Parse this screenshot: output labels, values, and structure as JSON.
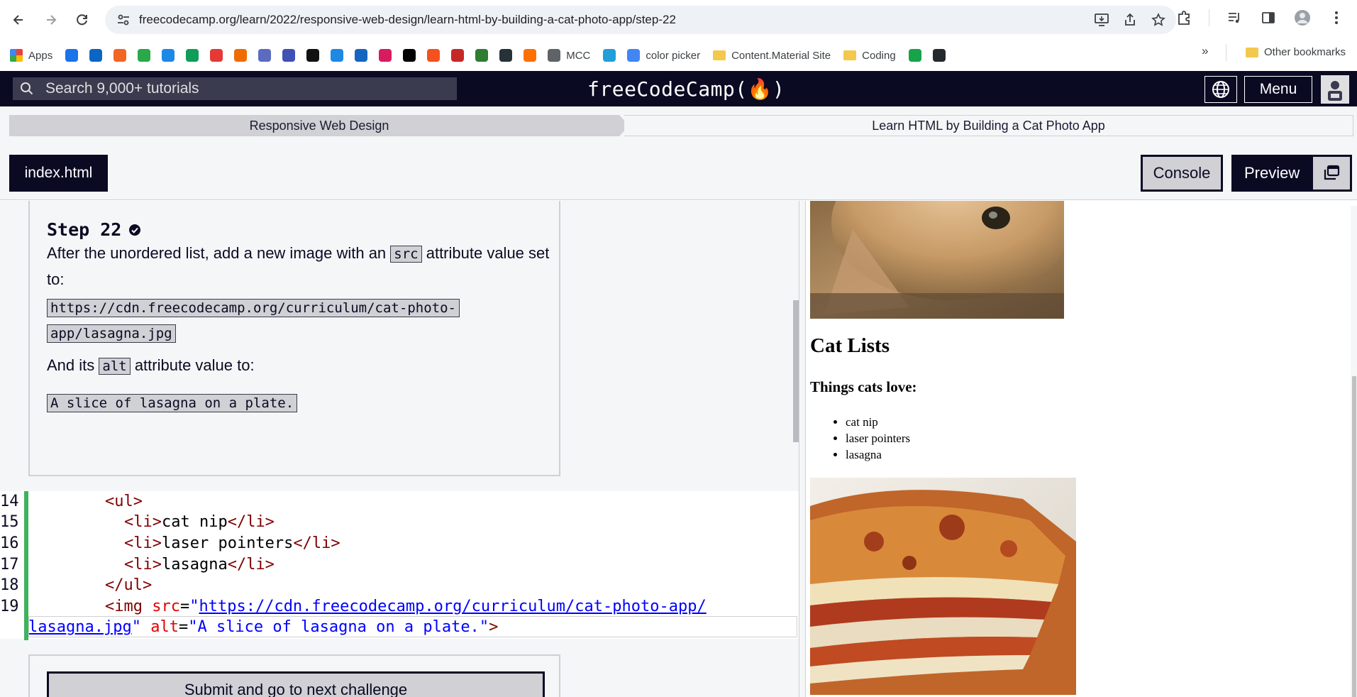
{
  "browser": {
    "url": "freecodecamp.org/learn/2022/responsive-web-design/learn-html-by-building-a-cat-photo-app/step-22",
    "bookmarks": [
      {
        "label": "Apps",
        "type": "apps"
      },
      {
        "label": "",
        "color": "#1a73e8"
      },
      {
        "label": "",
        "color": "#0a66c2"
      },
      {
        "label": "",
        "color": "#f26522"
      },
      {
        "label": "",
        "color": "#2aa84a"
      },
      {
        "label": "",
        "color": "#1e88e5"
      },
      {
        "label": "",
        "color": "#0f9d58"
      },
      {
        "label": "",
        "color": "#e53935"
      },
      {
        "label": "",
        "color": "#ef6c00"
      },
      {
        "label": "",
        "color": "#5c6bc0"
      },
      {
        "label": "",
        "color": "#3f51b5"
      },
      {
        "label": "",
        "color": "#111111"
      },
      {
        "label": "",
        "color": "#1e88e5"
      },
      {
        "label": "",
        "color": "#1565c0"
      },
      {
        "label": "",
        "color": "#d81b60"
      },
      {
        "label": "",
        "color": "#000000"
      },
      {
        "label": "",
        "color": "#f4511e"
      },
      {
        "label": "",
        "color": "#c62828"
      },
      {
        "label": "",
        "color": "#2e7d32"
      },
      {
        "label": "",
        "color": "#263238"
      },
      {
        "label": "",
        "color": "#ff6f00"
      },
      {
        "label": "MCC",
        "color": "#5f6368"
      },
      {
        "label": "",
        "color": "#229ed9"
      },
      {
        "label": "color picker",
        "color": "#4285f4"
      },
      {
        "label": "Content.Material Site",
        "type": "folder"
      },
      {
        "label": "Coding",
        "type": "folder"
      },
      {
        "label": "",
        "color": "#16a34a"
      },
      {
        "label": "",
        "color": "#24292e"
      }
    ],
    "more_bookmarks": "»",
    "other_bookmarks": "Other bookmarks"
  },
  "fcc": {
    "search_placeholder": "Search 9,000+ tutorials",
    "logo": "freeCodeCamp(🔥)",
    "menu_label": "Menu"
  },
  "breadcrumb": {
    "course": "Responsive Web Design",
    "project": "Learn HTML by Building a Cat Photo App"
  },
  "tabs": {
    "file": "index.html",
    "console": "Console",
    "preview": "Preview"
  },
  "instructions": {
    "title": "Step 22",
    "p1_before": "After the unordered list, add a new image with an ",
    "p1_code": "src",
    "p1_after": " attribute value set to:",
    "src_value_line1": "https://cdn.freecodecamp.org/curriculum/cat-photo-",
    "src_value_line2": "app/lasagna.jpg",
    "p2_before": "And its ",
    "p2_code": "alt",
    "p2_after": " attribute value to:",
    "alt_value": "A slice of lasagna on a plate."
  },
  "editor": {
    "lines": [
      {
        "num": "14",
        "indent": "        ",
        "code": "<ul>"
      },
      {
        "num": "15",
        "indent": "          ",
        "code": "<li>cat nip</li>"
      },
      {
        "num": "16",
        "indent": "          ",
        "code": "<li>laser pointers</li>"
      },
      {
        "num": "17",
        "indent": "          ",
        "code": "<li>lasagna</li>"
      },
      {
        "num": "18",
        "indent": "        ",
        "code": "</ul>"
      },
      {
        "num": "19",
        "indent": "        ",
        "code": "<img src=\"https://cdn.freecodecamp.org/curriculum/cat-photo-app/lasagna.jpg\" alt=\"A slice of lasagna on a plate.\">"
      }
    ],
    "line19_part1_url": "https://cdn.freecodecamp.org/curriculum/cat-photo-app/",
    "line19_part2_url": "lasagna.jpg",
    "line19_alt_value": "A slice of lasagna on a plate."
  },
  "submit_label": "Submit and go to next challenge",
  "preview": {
    "heading": "Cat Lists",
    "subheading": "Things cats love:",
    "items": [
      "cat nip",
      "laser pointers",
      "lasagna"
    ]
  }
}
